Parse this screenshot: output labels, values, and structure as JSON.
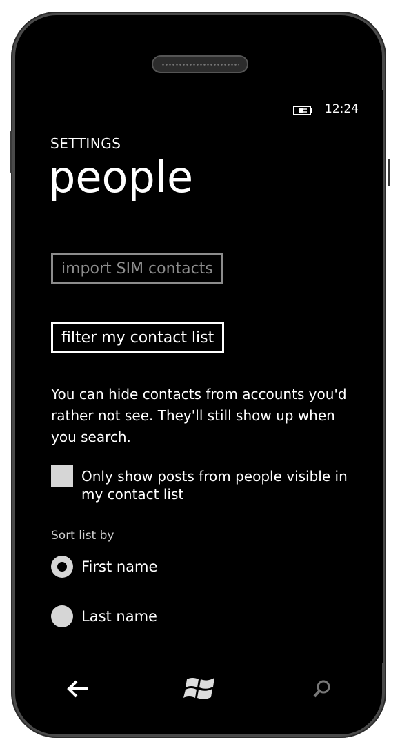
{
  "status_bar": {
    "time": "12:24",
    "battery_icon": "battery-charging-icon"
  },
  "header": {
    "app_title": "SETTINGS",
    "page_title": "people"
  },
  "buttons": {
    "import_sim": {
      "label": "import SIM contacts",
      "enabled": false
    },
    "filter_contacts": {
      "label": "filter my contact list",
      "enabled": true
    }
  },
  "description": "You can hide contacts from accounts you'd rather not see. They'll still show up when you search.",
  "checkbox": {
    "label": "Only show posts from people visible in my contact list",
    "checked": false
  },
  "sort": {
    "label": "Sort list by",
    "options": [
      {
        "label": "First name",
        "selected": true
      },
      {
        "label": "Last name",
        "selected": false
      }
    ]
  },
  "nav": {
    "back_icon": "back-arrow-icon",
    "start_icon": "windows-logo-icon",
    "search_icon": "search-icon"
  }
}
